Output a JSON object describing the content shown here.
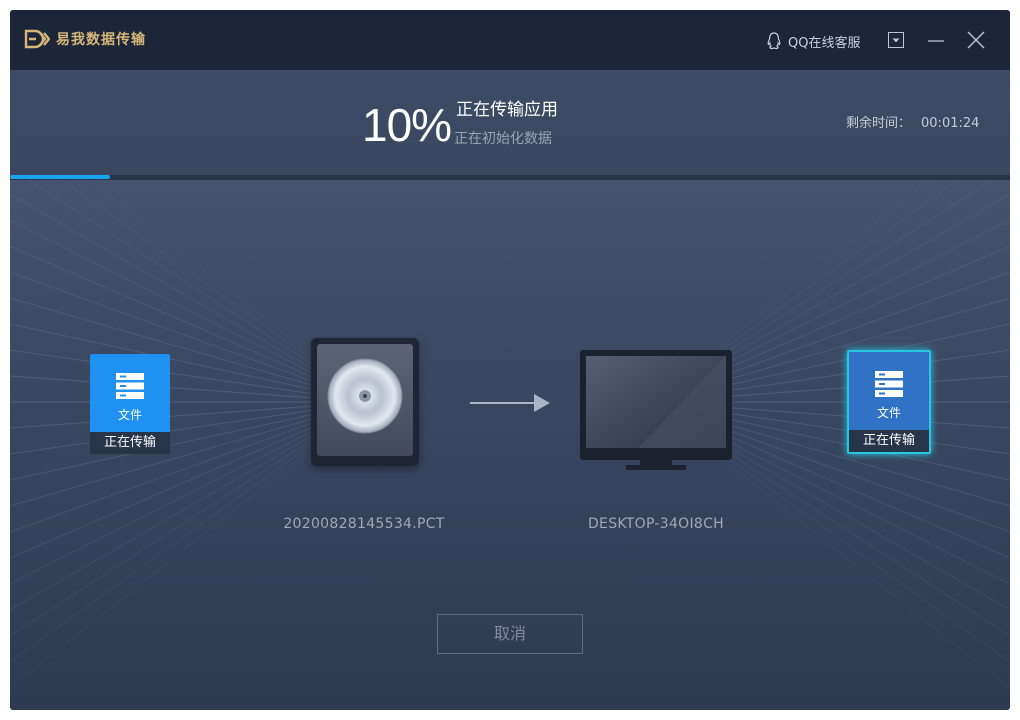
{
  "titlebar": {
    "app_title": "易我数据传输",
    "support_label": "QQ在线客服"
  },
  "progress": {
    "percent_text": "10%",
    "percent_value": 0.1,
    "status_main": "正在传输应用",
    "status_sub": "正在初始化数据",
    "remaining_label": "剩余时间：",
    "remaining_value": "00:01:24"
  },
  "source": {
    "card_label": "文件",
    "card_status": "正在传输",
    "name": "20200828145534.PCT"
  },
  "destination": {
    "card_label": "文件",
    "card_status": "正在传输",
    "name": "DESKTOP-34OI8CH"
  },
  "actions": {
    "cancel_label": "取消"
  },
  "colors": {
    "accent": "#1aa3f0",
    "title_gold": "#d6b77a",
    "card_blue": "#1e91f2",
    "card_highlight": "#29c6e0"
  }
}
